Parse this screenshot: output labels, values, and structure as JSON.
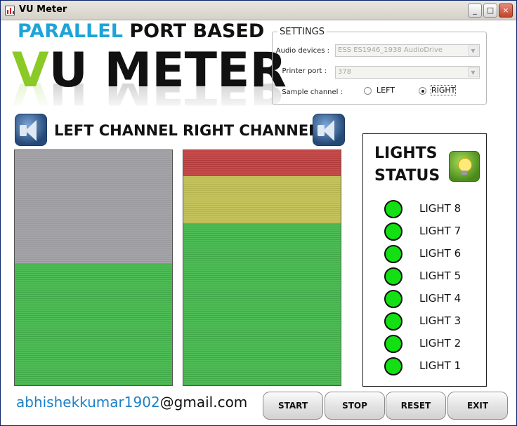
{
  "window": {
    "title": "VU Meter",
    "minimize": "_",
    "maximize": "□",
    "close": "×"
  },
  "logo": {
    "line1_a": "PARALLEL",
    "line1_b": " PORT BASED",
    "line2_v": "V",
    "line2_rest": "U METER"
  },
  "settings": {
    "legend": "SETTINGS",
    "audio_label": "Audio devices :",
    "audio_value": "ESS ES1946_1938 AudioDrive",
    "printer_label": "Printer port :",
    "printer_value": "378",
    "sample_label": "Sample channel :",
    "left_option": "LEFT",
    "right_option": "RIGHT",
    "selected": "RIGHT"
  },
  "channels": {
    "left_title": "LEFT CHANNEL",
    "right_title": "RIGHT CHANNEL"
  },
  "meters": {
    "left": {
      "level": 0.52,
      "green": 0.52,
      "yellow": 0,
      "red": 0
    },
    "right": {
      "level": 1.0,
      "green": 0.69,
      "yellow": 0.2,
      "red": 0.11
    }
  },
  "lights": {
    "title_line1": "LIGHTS",
    "title_line2": "STATUS",
    "led_color": "#13e013",
    "items": [
      {
        "label": "LIGHT 8",
        "on": true
      },
      {
        "label": "LIGHT 7",
        "on": true
      },
      {
        "label": "LIGHT 6",
        "on": true
      },
      {
        "label": "LIGHT 5",
        "on": true
      },
      {
        "label": "LIGHT 4",
        "on": true
      },
      {
        "label": "LIGHT 3",
        "on": true
      },
      {
        "label": "LIGHT 2",
        "on": true
      },
      {
        "label": "LIGHT 1",
        "on": true
      }
    ]
  },
  "email": {
    "user": "abhishekkumar1902",
    "domain": "@gmail.com"
  },
  "buttons": {
    "start": "START",
    "stop": "STOP",
    "reset": "RESET",
    "exit": "EXIT"
  }
}
